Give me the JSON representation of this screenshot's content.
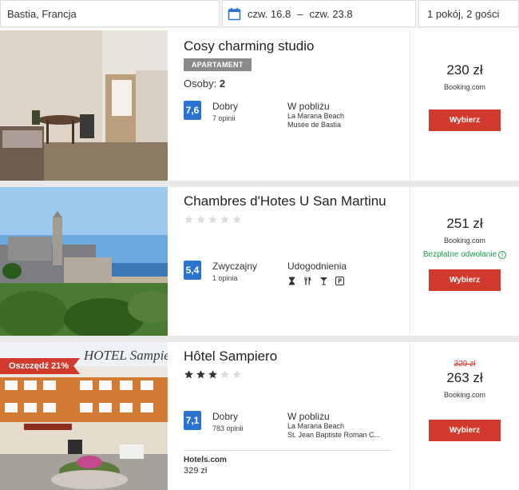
{
  "search": {
    "destination": "Bastia, Francja",
    "check_in": "czw. 16.8",
    "dash": "–",
    "check_out": "czw. 23.8",
    "guests": "1 pokój, 2 gości",
    "calendar_icon": "calendar-icon"
  },
  "listings": [
    {
      "title": "Cosy charming studio",
      "badge": "APARTAMENT",
      "guests_label": "Osoby:",
      "guests_value": "2",
      "score": "7,6",
      "rating_word": "Dobry",
      "reviews": "7 opinii",
      "nearby_label": "W pobliżu",
      "nearby": [
        "La Marana Beach",
        "Musée de Bastia"
      ],
      "price": "230 zł",
      "provider": "Booking.com",
      "button": "Wybierz"
    },
    {
      "title": "Chambres d'Hotes U San Martinu",
      "stars": 0,
      "score": "5,4",
      "rating_word": "Zwyczajny",
      "reviews": "1 opinia",
      "amenities_label": "Udogodnienia",
      "amenities": [
        "hourglass-icon",
        "restaurant-icon",
        "bar-icon",
        "parking-icon"
      ],
      "price": "251 zł",
      "provider": "Booking.com",
      "free_cancel": "Bezpłatne odwołanie",
      "button": "Wybierz"
    },
    {
      "title": "Hôtel Sampiero",
      "stars": 3,
      "savings": "Oszczędź 21%",
      "score": "7,1",
      "rating_word": "Dobry",
      "reviews": "783 opinii",
      "nearby_label": "W pobliżu",
      "nearby": [
        "La Marana Beach",
        "St. Jean Baptiste Roman C..."
      ],
      "old_price": "329 zł",
      "price": "263 zł",
      "provider": "Booking.com",
      "button": "Wybierz",
      "alt_provider": "Hotels.com",
      "alt_price": "329 zł",
      "sign_text": "HOTEL Sampiero"
    }
  ],
  "colors": {
    "score_blue": "#2a74cf",
    "button_red": "#d23a2e",
    "free_cancel_green": "#1c9c4c"
  }
}
